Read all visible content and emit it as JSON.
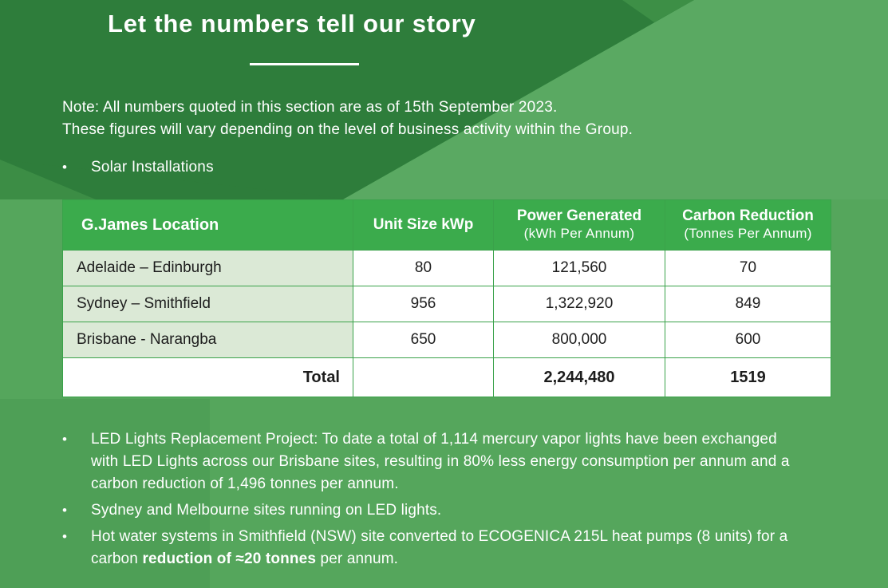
{
  "colors": {
    "background": "#57a85e",
    "background_dark": "#2b7a39",
    "header_green": "#3bab4c",
    "location_cell": "#dbe9d6",
    "text_light": "#ffffff",
    "text_dark": "#1d1d1d"
  },
  "heading": "Let the numbers tell our story",
  "note": {
    "line1": "Note: All numbers quoted in this section are as of 15th September 2023.",
    "line2": "These figures will vary depending on the level of business activity within the Group."
  },
  "bullet_marker": "•",
  "section_bullet": "Solar Installations",
  "table": {
    "headers": {
      "location": "G.James Location",
      "unit_size": "Unit Size kWp",
      "power_title": "Power Generated",
      "power_sub": "(kWh Per Annum)",
      "carbon_title": "Carbon Reduction",
      "carbon_sub": "(Tonnes Per Annum)"
    },
    "rows": [
      {
        "location": "Adelaide – Edinburgh",
        "unit_size": "80",
        "power": "121,560",
        "carbon": "70"
      },
      {
        "location": "Sydney – Smithfield",
        "unit_size": "956",
        "power": "1,322,920",
        "carbon": "849"
      },
      {
        "location": "Brisbane - Narangba",
        "unit_size": "650",
        "power": "800,000",
        "carbon": "600"
      }
    ],
    "total": {
      "label": "Total",
      "unit_size": "",
      "power": "2,244,480",
      "carbon": "1519"
    }
  },
  "bullets": {
    "led_project": "LED Lights Replacement Project: To date a total of 1,114 mercury vapor lights have been exchanged with LED Lights across our Brisbane sites, resulting in 80% less energy consumption per annum and a carbon reduction of 1,496 tonnes per annum.",
    "sydney_melbourne": "Sydney and Melbourne sites running on LED lights.",
    "hot_water_before": "Hot water systems in Smithfield (NSW) site converted to ECOGENICA 215L heat pumps (8 units) for a carbon ",
    "hot_water_bold": "reduction of ≈20 tonnes",
    "hot_water_after": " per annum."
  }
}
